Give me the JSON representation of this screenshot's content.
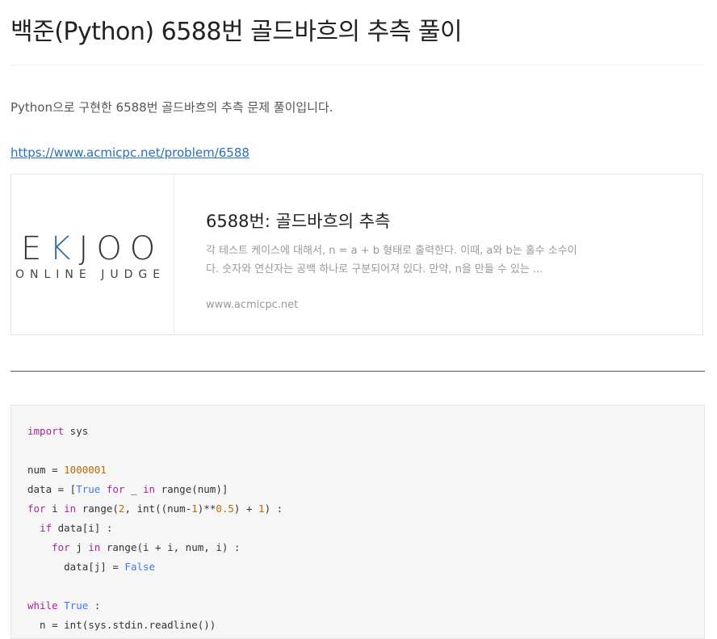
{
  "post": {
    "title": "백준(Python) 6588번 골드바흐의 추측 풀이",
    "intro": "Python으로 구현한 6588번 골드바흐의 추측 문제 풀이입니다.",
    "link": "https://www.acmicpc.net/problem/6588"
  },
  "card": {
    "logo_main_left": "E",
    "logo_main_k": "K",
    "logo_main_right": "JOO",
    "logo_sub": "ONLINE JUDGE",
    "title": "6588번: 골드바흐의 추측",
    "description": "각 테스트 케이스에 대해서, n = a + b 형태로 출력한다. 이때, a와 b는 홀수 소수이다. 숫자와 연산자는 공백 하나로 구분되어져 있다. 만약, n을 만들 수 있는 ...",
    "domain": "www.acmicpc.net"
  },
  "code_lines": [
    "import sys",
    "",
    "num = 1000001",
    "data = [True for _ in range(num)]",
    "for i in range(2, int((num-1)**0.5) + 1) :",
    "  if data[i] :",
    "    for j in range(i + i, num, i) :",
    "      data[j] = False",
    "",
    "while True :",
    "  n = int(sys.stdin.readline())"
  ],
  "colors": {
    "keyword": "#a626a4",
    "number": "#b76b01",
    "builtin": "#4078f2",
    "link": "#2a6ebb"
  }
}
